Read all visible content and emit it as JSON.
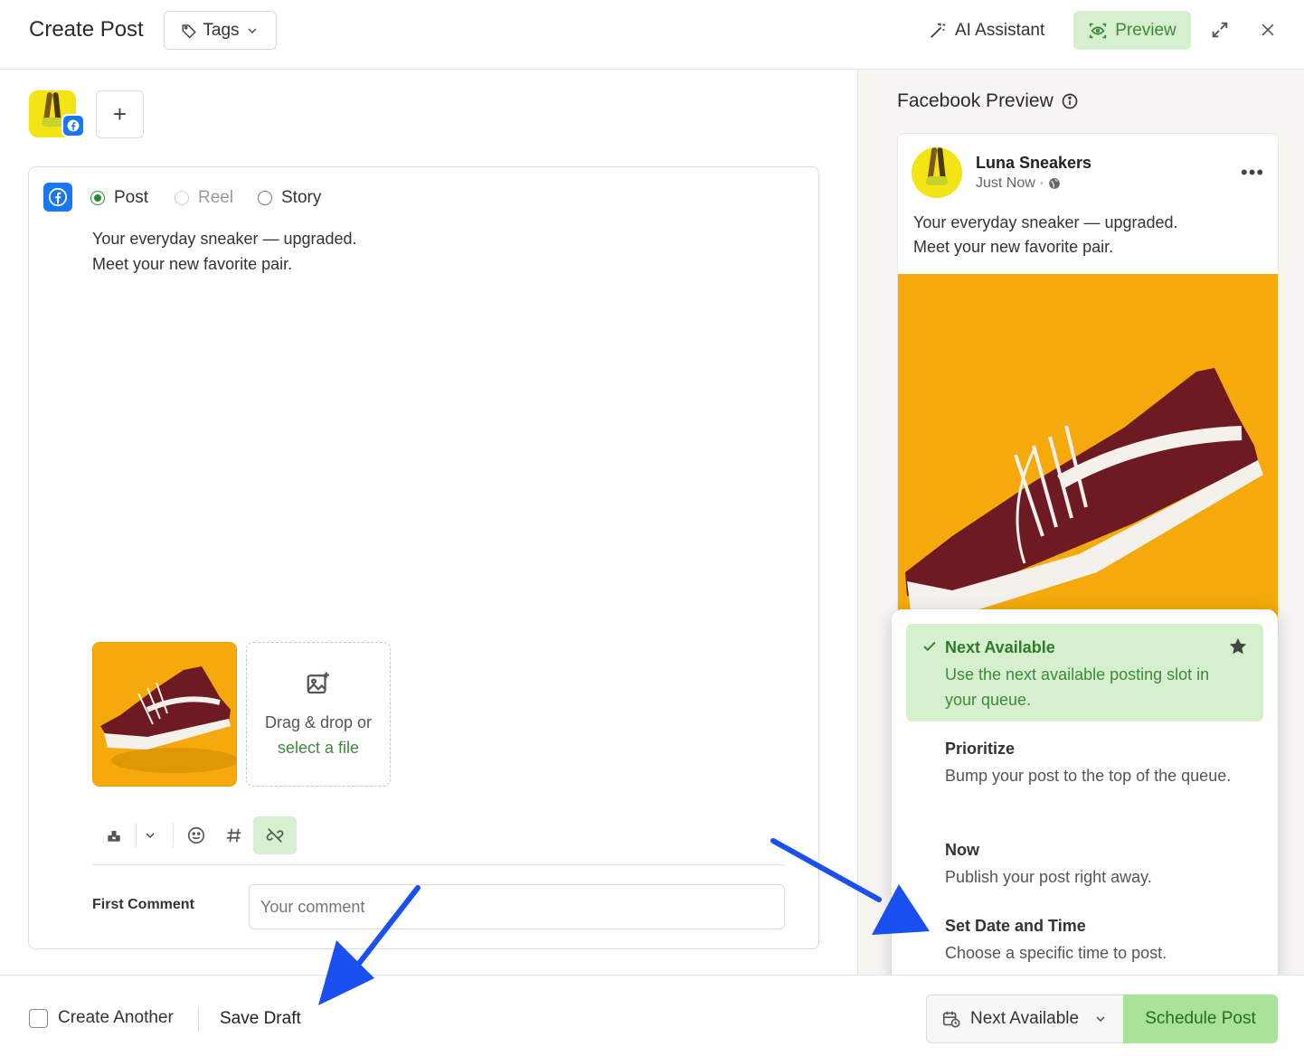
{
  "header": {
    "title": "Create Post",
    "tags_label": "Tags",
    "ai_assistant_label": "AI Assistant",
    "preview_label": "Preview"
  },
  "composer": {
    "post_types": [
      {
        "label": "Post",
        "selected": true,
        "disabled": false
      },
      {
        "label": "Reel",
        "selected": false,
        "disabled": true
      },
      {
        "label": "Story",
        "selected": false,
        "disabled": false
      }
    ],
    "text_line1": "Your everyday sneaker — upgraded.",
    "text_line2": "Meet your new favorite pair.",
    "dropzone_text": "Drag & drop or",
    "dropzone_link": "select a file",
    "first_comment_label": "First Comment",
    "first_comment_placeholder": "Your comment"
  },
  "preview": {
    "title": "Facebook Preview",
    "page_name": "Luna Sneakers",
    "timestamp": "Just Now ·",
    "text_line1": "Your everyday sneaker — upgraded.",
    "text_line2": "Meet your new favorite pair."
  },
  "schedule_options": [
    {
      "title": "Next Available",
      "desc": "Use the next available posting slot in your queue.",
      "selected": true
    },
    {
      "title": "Prioritize",
      "desc": "Bump your post to the top of the queue.",
      "selected": false
    },
    {
      "title": "Now",
      "desc": "Publish your post right away.",
      "selected": false
    },
    {
      "title": "Set Date and Time",
      "desc": "Choose a specific time to post.",
      "selected": false
    }
  ],
  "footer": {
    "create_another_label": "Create Another",
    "save_draft_label": "Save Draft",
    "schedule_select_value": "Next Available",
    "schedule_button_label": "Schedule Post"
  },
  "colors": {
    "accent_green": "#3f8a3a",
    "light_green": "#d5efcf",
    "facebook_blue": "#1877f2",
    "annotation_arrow": "#1a4ff0"
  },
  "icons": {
    "tags": "tag-icon",
    "ai_assistant": "magic-wand-icon",
    "preview": "eye-scan-icon",
    "expand": "expand-icon",
    "close": "close-icon",
    "info": "info-icon",
    "globe": "globe-icon",
    "more": "more-dots-icon",
    "calendar": "calendar-clock-icon"
  }
}
